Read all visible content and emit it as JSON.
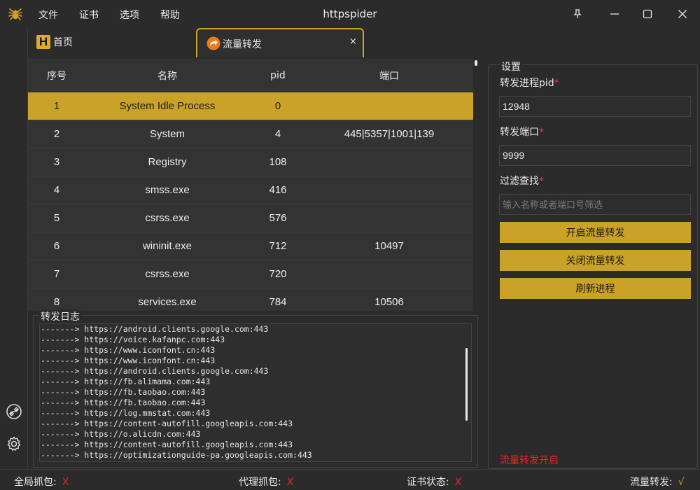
{
  "window": {
    "title": "httpspider"
  },
  "menu": [
    "文件",
    "证书",
    "选项",
    "帮助"
  ],
  "tabs": {
    "home": {
      "label": "首页",
      "logo_letter": "H"
    },
    "active": {
      "label": "流量转发",
      "close": "×"
    }
  },
  "table": {
    "headers": [
      "序号",
      "名称",
      "pid",
      "端口"
    ],
    "rows": [
      [
        "1",
        "System Idle Process",
        "0",
        ""
      ],
      [
        "2",
        "System",
        "4",
        "445|5357|1001|139"
      ],
      [
        "3",
        "Registry",
        "108",
        ""
      ],
      [
        "4",
        "smss.exe",
        "416",
        ""
      ],
      [
        "5",
        "csrss.exe",
        "576",
        ""
      ],
      [
        "6",
        "wininit.exe",
        "712",
        "10497"
      ],
      [
        "7",
        "csrss.exe",
        "720",
        ""
      ],
      [
        "8",
        "services.exe",
        "784",
        "10506"
      ]
    ],
    "selected_row": 0
  },
  "log": {
    "title": "转发日志",
    "lines": [
      "-------> https://android.clients.google.com:443",
      "-------> https://voice.kafanpc.com:443",
      "-------> https://www.iconfont.cn:443",
      "-------> https://www.iconfont.cn:443",
      "-------> https://android.clients.google.com:443",
      "-------> https://fb.alimama.com:443",
      "-------> https://fb.taobao.com:443",
      "-------> https://fb.taobao.com:443",
      "-------> https://log.mmstat.com:443",
      "-------> https://content-autofill.googleapis.com:443",
      "-------> https://o.alicdn.com:443",
      "-------> https://content-autofill.googleapis.com:443",
      "-------> https://optimizationguide-pa.googleapis.com:443"
    ]
  },
  "settings": {
    "title": "设置",
    "pid_label": "转发进程pid",
    "pid_value": "12948",
    "port_label": "转发端口",
    "port_value": "9999",
    "filter_label": "过滤查找",
    "filter_placeholder": "输入名称或者端口号筛选",
    "required_mark": "*",
    "btn_start": "开启流量转发",
    "btn_stop": "关闭流量转发",
    "btn_refresh": "刷新进程",
    "status_text": "流量转发开启"
  },
  "statusbar": {
    "global_capture_label": "全局抓包:",
    "global_capture_value": "X",
    "proxy_capture_label": "代理抓包:",
    "proxy_capture_value": "X",
    "cert_status_label": "证书状态:",
    "cert_status_value": "X",
    "forward_label": "流量转发:",
    "forward_value": "√"
  },
  "colors": {
    "accent": "#c9a227",
    "error": "#e22222",
    "background": "#2b2b2b"
  }
}
